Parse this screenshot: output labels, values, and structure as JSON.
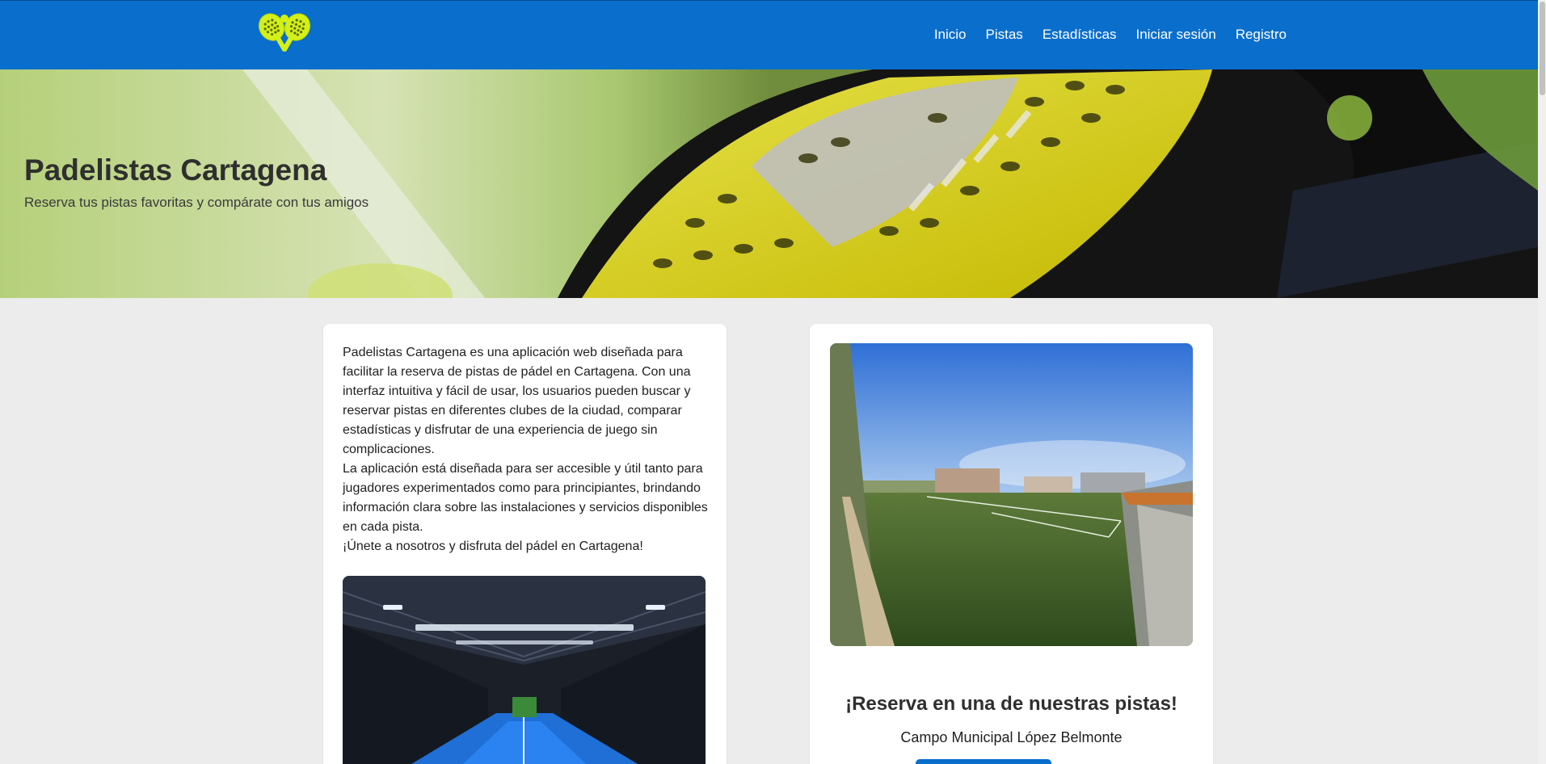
{
  "brand": {
    "logo_icon": "crossed-padel-rackets-icon",
    "primary_color": "#0a6ecd",
    "accent_color": "#d4f018"
  },
  "nav": {
    "items": [
      {
        "label": "Inicio"
      },
      {
        "label": "Pistas"
      },
      {
        "label": "Estadísticas"
      },
      {
        "label": "Iniciar sesión"
      },
      {
        "label": "Registro"
      }
    ]
  },
  "hero": {
    "title": "Padelistas Cartagena",
    "subtitle": "Reserva tus pistas favoritas y compárate con tus amigos"
  },
  "about": {
    "paragraphs": [
      "Padelistas Cartagena es una aplicación web diseñada para facilitar la reserva de pistas de pádel en Cartagena. Con una interfaz intuitiva y fácil de usar, los usuarios pueden buscar y reservar pistas en diferentes clubes de la ciudad, comparar estadísticas y disfrutar de una experiencia de juego sin complicaciones.",
      "La aplicación está diseñada para ser accesible y útil tanto para jugadores experimentados como para principiantes, brindando información clara sobre las instalaciones y servicios disponibles en cada pista.",
      "¡Únete a nosotros y disfruta del pádel en Cartagena!"
    ]
  },
  "reserve": {
    "title": "¡Reserva en una de nuestras pistas!",
    "court_name": "Campo Municipal López Belmonte"
  }
}
